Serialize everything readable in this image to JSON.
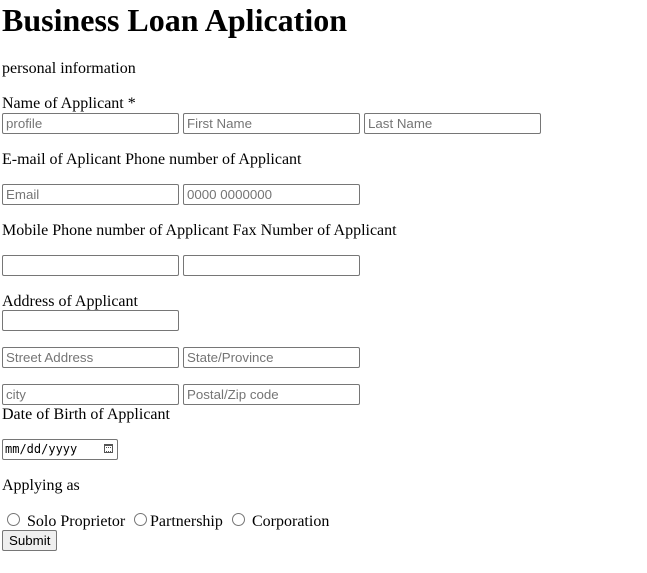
{
  "page": {
    "title": "Business Loan Aplication",
    "section_label": "personal information"
  },
  "applicant_name": {
    "label": "Name of Applicant *",
    "profile_placeholder": "profile",
    "first_name_placeholder": "First Name",
    "last_name_placeholder": "Last Name"
  },
  "contact": {
    "label": "E-mail of Aplicant Phone number of Applicant",
    "email_placeholder": "Email",
    "phone_placeholder": "0000 0000000"
  },
  "mobile_fax": {
    "label": "Mobile Phone number of Applicant Fax Number of Applicant",
    "mobile_value": "",
    "fax_value": ""
  },
  "address": {
    "label": "Address of Applicant",
    "address_value": "",
    "street_placeholder": "Street Address",
    "state_placeholder": "State/Province",
    "city_placeholder": "city",
    "postal_placeholder": "Postal/Zip code"
  },
  "birth": {
    "label": "Date of Birth of Applicant",
    "date_placeholder": "mm/dd/yyyy",
    "icon": "calendar-icon"
  },
  "applying_as": {
    "label": "Applying as",
    "options": [
      "Solo Proprietor",
      "Partnership",
      "Corporation"
    ]
  },
  "actions": {
    "submit_label": "Submit"
  }
}
